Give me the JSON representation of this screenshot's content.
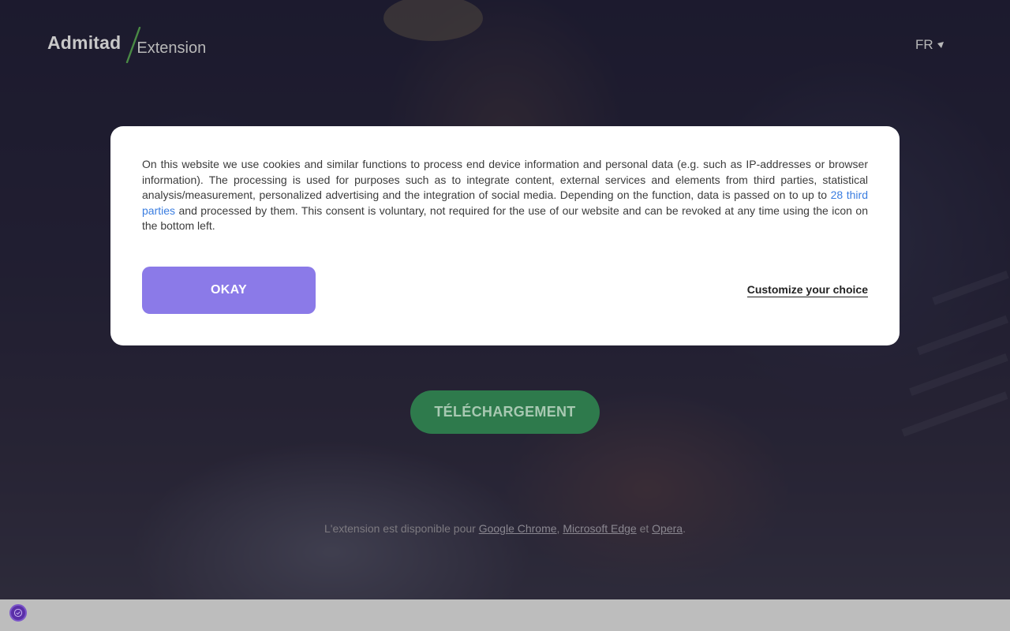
{
  "header": {
    "logo_main": "Admitad",
    "logo_sub": "Extension",
    "language": "FR"
  },
  "hero": {
    "download_label": "TÉLÉCHARGEMENT",
    "availability_prefix": "L'extension est disponible pour ",
    "browser_chrome": "Google Chrome",
    "separator_comma": ",",
    "browser_edge": "Microsoft Edge",
    "conjunction": " et ",
    "browser_opera": "Opera",
    "period": "."
  },
  "consent": {
    "text_before_link": "On this website we use cookies and similar functions to process end device information and personal data (e.g. such as IP-addresses or browser information). The processing is used for purposes such as to integrate content, external services and elements from third parties, statistical analysis/measurement, personalized advertising and the integration of social media. Depending on the function, data is passed on to up to ",
    "third_parties_link": "28 third parties",
    "text_after_link": " and processed by them. This consent is voluntary, not required for the use of our website and can be revoked at any time using the icon on the bottom left.",
    "okay_label": "OKAY",
    "customize_label": "Customize your choice"
  },
  "colors": {
    "okay_button": "#8b7ae8",
    "download_button": "#2e7a4c",
    "link": "#3a7de0",
    "logo_accent": "#4caf50",
    "privacy_icon": "#5a2fa8"
  },
  "icons": {
    "language_caret": "caret-down-icon",
    "privacy_settings": "privacy-shield-icon"
  }
}
